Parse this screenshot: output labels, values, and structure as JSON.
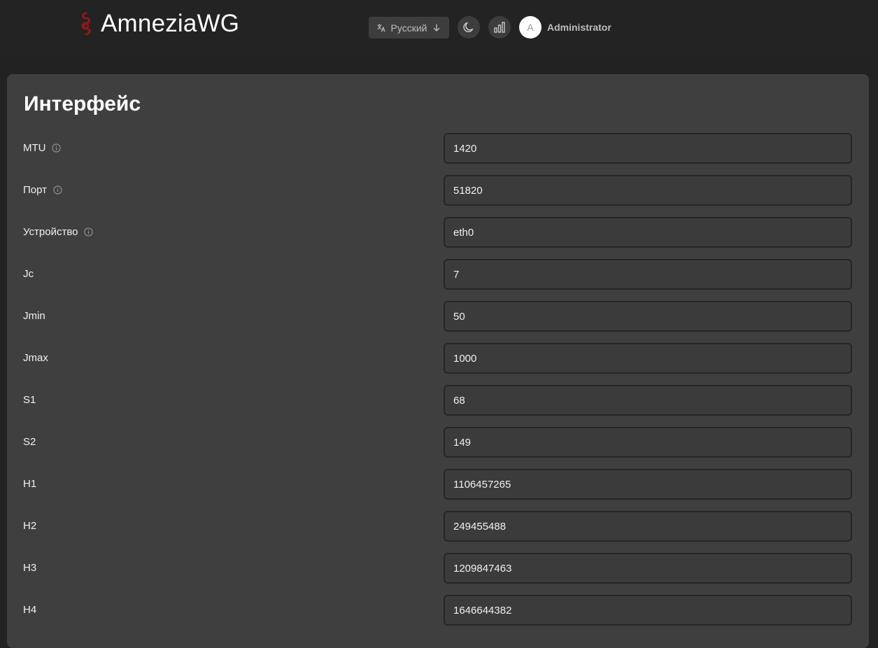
{
  "header": {
    "brand": "AmneziaWG",
    "language": "Русский",
    "user_initial": "A",
    "username": "Administrator"
  },
  "colors": {
    "accent": "#8b1a1a",
    "background": "#222222",
    "panel": "#3f3f3f"
  },
  "icons": {
    "logo": "amnezia-logo-icon",
    "language": "translate-icon",
    "language_arrow": "arrow-down-icon",
    "theme": "moon-icon",
    "stats": "bar-chart-icon",
    "info": "info-icon"
  },
  "section": {
    "title": "Интерфейс",
    "fields": [
      {
        "label": "MTU",
        "value": "1420",
        "info": true
      },
      {
        "label": "Порт",
        "value": "51820",
        "info": true
      },
      {
        "label": "Устройство",
        "value": "eth0",
        "info": true
      },
      {
        "label": "Jc",
        "value": "7",
        "info": false
      },
      {
        "label": "Jmin",
        "value": "50",
        "info": false
      },
      {
        "label": "Jmax",
        "value": "1000",
        "info": false
      },
      {
        "label": "S1",
        "value": "68",
        "info": false
      },
      {
        "label": "S2",
        "value": "149",
        "info": false
      },
      {
        "label": "H1",
        "value": "1106457265",
        "info": false
      },
      {
        "label": "H2",
        "value": "249455488",
        "info": false
      },
      {
        "label": "H3",
        "value": "1209847463",
        "info": false
      },
      {
        "label": "H4",
        "value": "1646644382",
        "info": false
      }
    ]
  }
}
